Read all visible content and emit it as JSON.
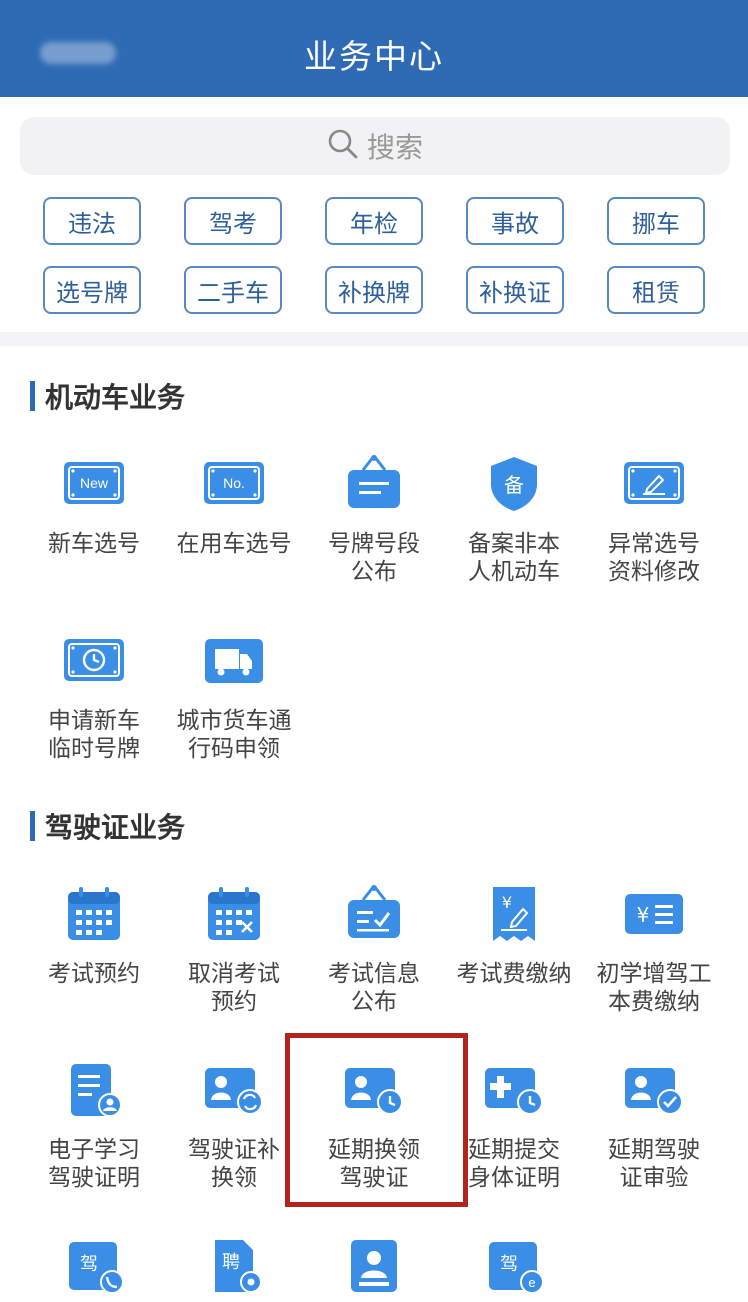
{
  "header": {
    "title": "业务中心"
  },
  "search": {
    "placeholder": "搜索"
  },
  "tags": [
    "违法",
    "驾考",
    "年检",
    "事故",
    "挪车",
    "选号牌",
    "二手车",
    "补换牌",
    "补换证",
    "租赁"
  ],
  "sections": [
    {
      "title": "机动车业务",
      "items": [
        {
          "label": "新车选号",
          "icon": "new-plate-icon"
        },
        {
          "label": "在用车选号",
          "icon": "no-plate-icon"
        },
        {
          "label": "号牌号段\n公布",
          "icon": "notice-board-icon"
        },
        {
          "label": "备案非本\n人机动车",
          "icon": "shield-record-icon"
        },
        {
          "label": "异常选号\n资料修改",
          "icon": "edit-plate-icon"
        },
        {
          "label": "申请新车\n临时号牌",
          "icon": "temp-plate-clock-icon"
        },
        {
          "label": "城市货车通\n行码申领",
          "icon": "truck-icon"
        }
      ]
    },
    {
      "title": "驾驶证业务",
      "items": [
        {
          "label": "考试预约",
          "icon": "calendar-icon"
        },
        {
          "label": "取消考试\n预约",
          "icon": "calendar-cancel-icon"
        },
        {
          "label": "考试信息\n公布",
          "icon": "exam-notice-icon"
        },
        {
          "label": "考试费缴纳",
          "icon": "fee-receipt-icon"
        },
        {
          "label": "初学增驾工\n本费缴纳",
          "icon": "yuan-card-icon"
        },
        {
          "label": "电子学习\n驾驶证明",
          "icon": "document-user-icon"
        },
        {
          "label": "驾驶证补\n换领",
          "icon": "license-exchange-icon"
        },
        {
          "label": "延期换领\n驾驶证",
          "icon": "license-clock-icon"
        },
        {
          "label": "延期提交\n身体证明",
          "icon": "medical-clock-icon"
        },
        {
          "label": "延期驾驶\n证审验",
          "icon": "license-check-icon"
        },
        {
          "label": "",
          "icon": "jia-phone-icon"
        },
        {
          "label": "",
          "icon": "pin-gear-icon"
        },
        {
          "label": "",
          "icon": "person-stamp-icon"
        },
        {
          "label": "",
          "icon": "jia-e-icon"
        }
      ]
    }
  ],
  "colors": {
    "primary": "#2e6bb4",
    "icon_blue": "#3a8ee6",
    "highlight": "#b0251e"
  }
}
